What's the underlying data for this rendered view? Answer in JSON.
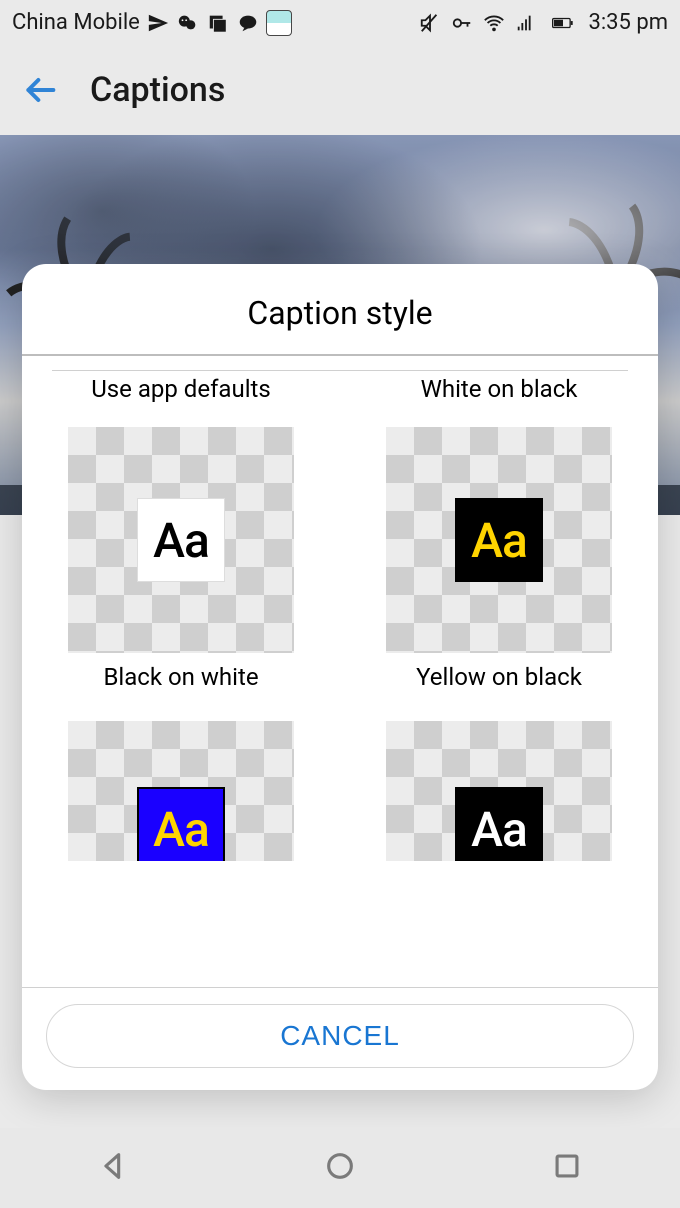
{
  "status": {
    "carrier": "China Mobile",
    "time": "3:35 pm"
  },
  "header": {
    "title": "Captions"
  },
  "dialog": {
    "title": "Caption style",
    "options": [
      {
        "label": "Use app defaults"
      },
      {
        "label": "White on black"
      },
      {
        "label": "Black on white"
      },
      {
        "label": "Yellow on black"
      }
    ],
    "sample_text": "Aa",
    "cancel_label": "CANCEL"
  }
}
